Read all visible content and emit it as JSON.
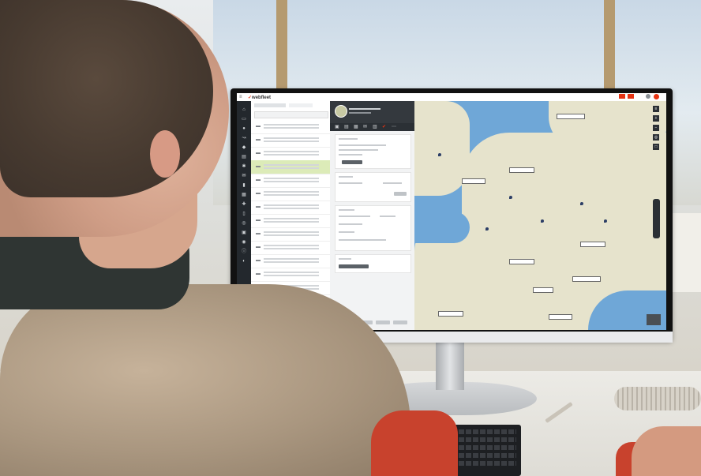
{
  "scene": {
    "description_colors": {
      "wall": "#e6e8e8",
      "desk": "#e6e4de",
      "monitor_bezel": "#111111"
    }
  },
  "app": {
    "brand": "webfleet",
    "brand_color": "#e63312",
    "map_water": "#6fa7d7",
    "map_land": "#e6e3cc",
    "rail_color": "#23282d",
    "selected_row_color": "#dcebb8"
  },
  "icons": {
    "rail": [
      "home-icon",
      "truck-icon",
      "person-icon",
      "route-icon",
      "pin-icon",
      "chart-icon",
      "settings-icon",
      "message-icon",
      "fuel-icon",
      "calendar-icon",
      "tools-icon"
    ],
    "detail_tabs": [
      "info-icon",
      "route-icon",
      "stats-icon",
      "message-icon",
      "alert-icon"
    ],
    "map_tools": [
      "layers-icon",
      "zoom-in-icon",
      "zoom-out-icon",
      "locate-icon",
      "fullscreen-icon"
    ]
  }
}
